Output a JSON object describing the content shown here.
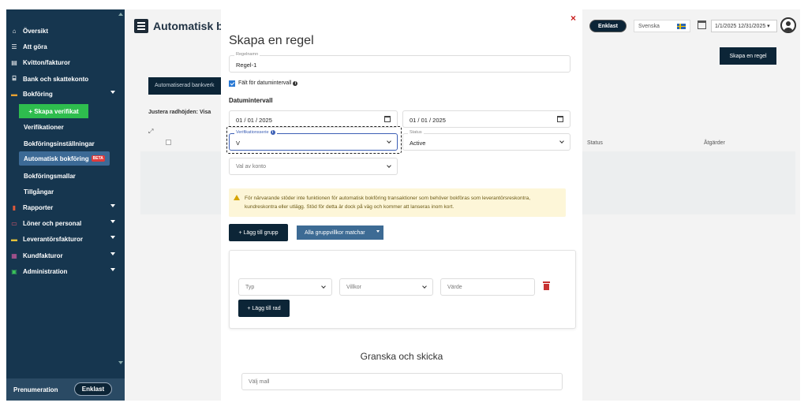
{
  "sidebar": {
    "items": [
      {
        "label": "Översikt",
        "icon": "home-icon",
        "glyph": "⌂"
      },
      {
        "label": "Att göra",
        "icon": "todo-icon",
        "glyph": "☰"
      },
      {
        "label": "Kvitton/fakturor",
        "icon": "receipt-icon",
        "glyph": "▤"
      },
      {
        "label": "Bank och skattekonto",
        "icon": "bank-icon",
        "glyph": "⌸"
      },
      {
        "label": "Bokföring",
        "icon": "book-icon",
        "glyph": "▬"
      }
    ],
    "skapa_verifikat": "+ Skapa verifikat",
    "subitems": [
      "Verifikationer",
      "Bokföringsinställningar",
      "Automatisk bokföring",
      "Bokföringsmallar",
      "Tillgångar"
    ],
    "beta": "BETA",
    "items2": [
      {
        "label": "Rapporter",
        "icon": "chart-icon",
        "glyph": "▮"
      },
      {
        "label": "Löner och personal",
        "icon": "payroll-icon",
        "glyph": "▭"
      },
      {
        "label": "Leverantörsfakturor",
        "icon": "supplier-icon",
        "glyph": "▬"
      },
      {
        "label": "Kundfakturor",
        "icon": "customer-icon",
        "glyph": "▦"
      },
      {
        "label": "Administration",
        "icon": "admin-icon",
        "glyph": "▣"
      }
    ],
    "prenumeration": "Prenumeration",
    "enklast": "Enklast"
  },
  "header": {
    "title": "Automatisk b",
    "enklast": "Enklast",
    "language": "Svenska",
    "daterange": "1/1/2025 12/31/2025 ▾"
  },
  "page": {
    "skapa_regel": "Skapa en regel",
    "automatiserad": "Automatiserad bankverk",
    "justera": "Justera radhöjden:  Visa",
    "status_col": "Status",
    "atgarder_col": "Åtgärder"
  },
  "modal": {
    "title": "Skapa en regel",
    "close": "×",
    "regelnamn_label": "Regelnamn",
    "regelnamn_value": "Regel-1",
    "checkbox_label": "Fält för datumintervall",
    "info": "i",
    "datumintervall": "Datumintervall",
    "date_from": "01 / 01 / 2025",
    "date_to": "01 / 01 / 2025",
    "verserie_label": "Verifikationsserie",
    "verserie_value": "V",
    "status_label": "Status",
    "status_value": "Active",
    "konto_placeholder": "Val av konto",
    "warning": "För närvarande stöder inte funktionen för automatisk bokföring transaktioner som behöver bokföras som leverantörsreskontra, kundreskontra eller utlägg. Stöd för detta är dock på väg och kommer att lanseras inom kort.",
    "lagg_till_grupp": "+  Lägg till grupp",
    "alla_gruppvillkor": "Alla gruppvillkor matchar",
    "typ": "Typ",
    "villkor": "Villkor",
    "varde": "Värde",
    "lagg_till_rad": "+  Lägg till rad",
    "granska": "Granska och skicka",
    "valj_mall": "Välj mall"
  }
}
